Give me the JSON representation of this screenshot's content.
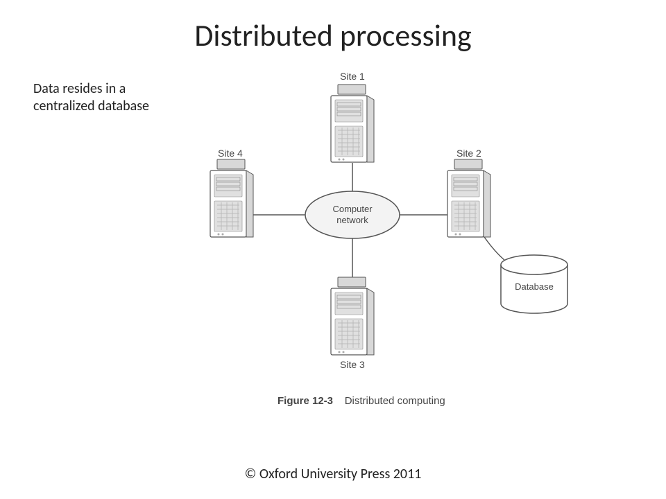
{
  "title": "Distributed processing",
  "note": "Data resides in a centralized database",
  "footer": "© Oxford University Press 2011",
  "diagram": {
    "sites": {
      "site1": "Site 1",
      "site2": "Site 2",
      "site3": "Site 3",
      "site4": "Site 4"
    },
    "hub_label_line1": "Computer",
    "hub_label_line2": "network",
    "database_label": "Database",
    "caption_number": "Figure 12-3",
    "caption_text": "Distributed computing"
  }
}
